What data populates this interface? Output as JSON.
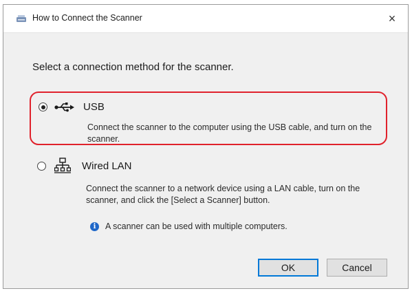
{
  "window": {
    "title": "How to Connect the Scanner",
    "close_glyph": "×",
    "icon": "scanner-app-icon"
  },
  "prompt": "Select a connection method for the scanner.",
  "options": [
    {
      "label": "USB",
      "icon": "usb-icon",
      "selected": true,
      "description": "Connect the scanner to the computer using the USB cable, and turn on the scanner."
    },
    {
      "label": "Wired LAN",
      "icon": "wired-lan-icon",
      "selected": false,
      "description": "Connect the scanner to a network device using a LAN cable, turn on the scanner, and click the [Select a Scanner] button."
    }
  ],
  "info": {
    "icon": "info-icon",
    "glyph": "i",
    "text": "A scanner can be used with multiple computers."
  },
  "buttons": {
    "ok": "OK",
    "cancel": "Cancel"
  },
  "colors": {
    "highlight": "#e0212b",
    "focus": "#0078d7",
    "info": "#1f67c8"
  }
}
